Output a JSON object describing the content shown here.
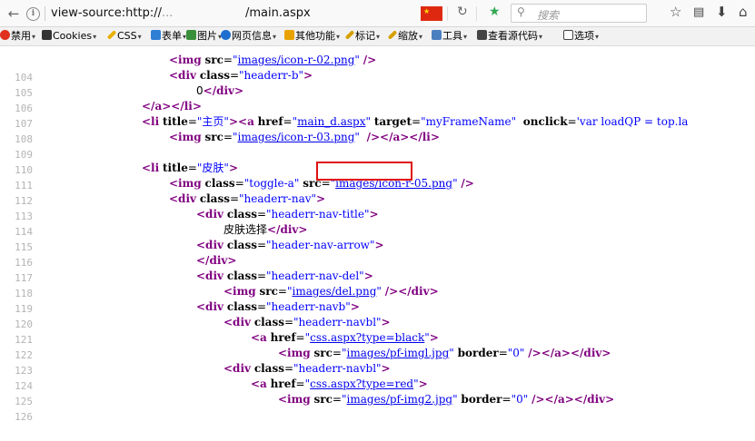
{
  "browser": {
    "back_icon": "arrow-left-icon",
    "url_prefix": "view-source:http://",
    "url_hidden": "...",
    "url_file": "/main.aspx",
    "search_placeholder": "搜索"
  },
  "toolbar": {
    "items": [
      {
        "label": "禁用",
        "icon": "forbidden-icon",
        "color": "#e0301e"
      },
      {
        "label": "Cookies",
        "icon": "user-icon",
        "color": "#333333"
      },
      {
        "label": "CSS",
        "icon": "wand-icon",
        "color": "#e8b000"
      },
      {
        "label": "表单",
        "icon": "form-icon",
        "color": "#2f7fd5"
      },
      {
        "label": "图片",
        "icon": "image-icon",
        "color": "#3a8f3a"
      },
      {
        "label": "网页信息",
        "icon": "info-icon",
        "color": "#1f6fd0"
      },
      {
        "label": "其他功能",
        "icon": "folder-icon",
        "color": "#e8a200"
      },
      {
        "label": "标记",
        "icon": "pencil-icon",
        "color": "#d6a000"
      },
      {
        "label": "缩放",
        "icon": "resize-icon",
        "color": "#d6a000"
      },
      {
        "label": "工具",
        "icon": "tools-icon",
        "color": "#4a7fc0"
      },
      {
        "label": "查看源代码",
        "icon": "monitor-icon",
        "color": "#444444"
      },
      {
        "label": "选项",
        "icon": "options-icon",
        "color": "#444444"
      }
    ]
  },
  "source": {
    "lines": [
      {
        "n": "104",
        "text": "<img src=\"images/icon-r-02.png\" />"
      },
      {
        "n": "105",
        "text": "<div class=\"headerr-b\">"
      },
      {
        "n": "106",
        "text": "0</div>"
      },
      {
        "n": "107",
        "text": "</a></li>"
      },
      {
        "n": "108",
        "text": "<li title=\"主页\"><a href=\"main_d.aspx\" target=\"myFrameName\"  onclick='var loadQP = top.la"
      },
      {
        "n": "109",
        "text": "<img src=\"images/icon-r-03.png\"  /></a></li>"
      },
      {
        "n": "110",
        "text": ""
      },
      {
        "n": "111",
        "text": "<li title=\"皮肤\">"
      },
      {
        "n": "112",
        "text": "<img class=\"toggle-a\" src=\"images/icon-r-05.png\" />"
      },
      {
        "n": "113",
        "text": "<div class=\"headerr-nav\">"
      },
      {
        "n": "114",
        "text": "<div class=\"headerr-nav-title\">"
      },
      {
        "n": "115",
        "text": "皮肤选择</div>"
      },
      {
        "n": "116",
        "text": "<div class=\"header-nav-arrow\">"
      },
      {
        "n": "117",
        "text": "</div>"
      },
      {
        "n": "118",
        "text": "<div class=\"headerr-nav-del\">"
      },
      {
        "n": "119",
        "text": "<img src=\"images/del.png\" /></div>"
      },
      {
        "n": "120",
        "text": "<div class=\"headerr-navb\">"
      },
      {
        "n": "121",
        "text": "<div class=\"headerr-navbl\">"
      },
      {
        "n": "122",
        "text": "<a href=\"css.aspx?type=black\">"
      },
      {
        "n": "123",
        "text": "<img src=\"images/pf-imgl.jpg\" border=\"0\" /></a></div>"
      },
      {
        "n": "124",
        "text": "<div class=\"headerr-navbl\">"
      },
      {
        "n": "125",
        "text": "<a href=\"css.aspx?type=red\">"
      },
      {
        "n": "126",
        "text": "<img src=\"images/pf-img2.jpg\" border=\"0\" /></a></div>"
      }
    ]
  },
  "highlight": {
    "note": "main_d.aspx",
    "color": "#e01010"
  }
}
